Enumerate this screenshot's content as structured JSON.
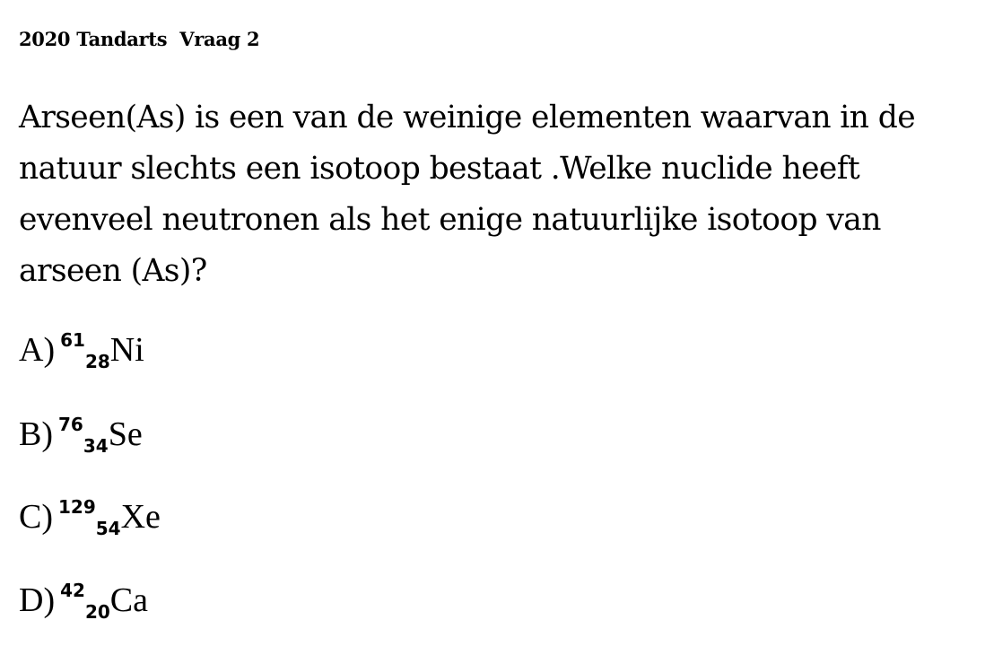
{
  "header": {
    "title": "2020 Tandarts  Vraag 2"
  },
  "question": {
    "lines": [
      "Arseen(As) is een van de weinige elementen waarvan in de",
      "natuur slechts een isotoop bestaat .Welke nuclide heeft",
      "evenveel neutronen als het enige natuurlijke isotoop van",
      "arseen (As)?"
    ]
  },
  "options": [
    {
      "label": "A)",
      "mass": "61",
      "atomic": "28",
      "symbol": "Ni"
    },
    {
      "label": "B)",
      "mass": "76",
      "atomic": "34",
      "symbol": "Se"
    },
    {
      "label": "C)",
      "mass": "129",
      "atomic": "54",
      "symbol": "Xe"
    },
    {
      "label": "D)",
      "mass": "42",
      "atomic": "20",
      "symbol": "Ca"
    }
  ]
}
